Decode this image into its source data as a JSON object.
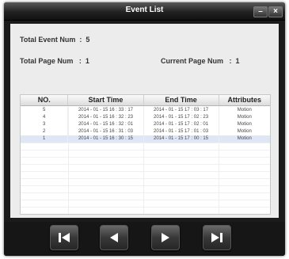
{
  "window": {
    "title": "Event List"
  },
  "info": {
    "total_event": "Total Event Num  :  5",
    "total_page": "Total Page Num   :  1",
    "current_page": "Current Page Num   :  1"
  },
  "table": {
    "headers": [
      "NO.",
      "Start Time",
      "End Time",
      "Attributes"
    ],
    "rows": [
      [
        "5",
        "2014 - 01 - 15   16 : 33 : 17",
        "2014 - 01 - 15   17 : 03 : 17",
        "Motion"
      ],
      [
        "4",
        "2014 - 01 - 15   16 : 32 : 23",
        "2014 - 01 - 15   17 : 02 : 23",
        "Motion"
      ],
      [
        "3",
        "2014 - 01 - 15   16 : 32 : 01",
        "2014 - 01 - 15   17 : 02 : 01",
        "Motion"
      ],
      [
        "2",
        "2014 - 01 - 15   16 : 31 : 03",
        "2014 - 01 - 15   17 : 01 : 03",
        "Motion"
      ],
      [
        "1",
        "2014 - 01 - 15   16 : 30 : 15",
        "2014 - 01 - 15   17 : 00 : 15",
        "Motion"
      ]
    ]
  },
  "icons": {
    "minimize": "minimize-icon",
    "close": "close-icon",
    "first": "skip-first-icon",
    "prev": "previous-icon",
    "next": "next-icon",
    "last": "skip-last-icon"
  }
}
